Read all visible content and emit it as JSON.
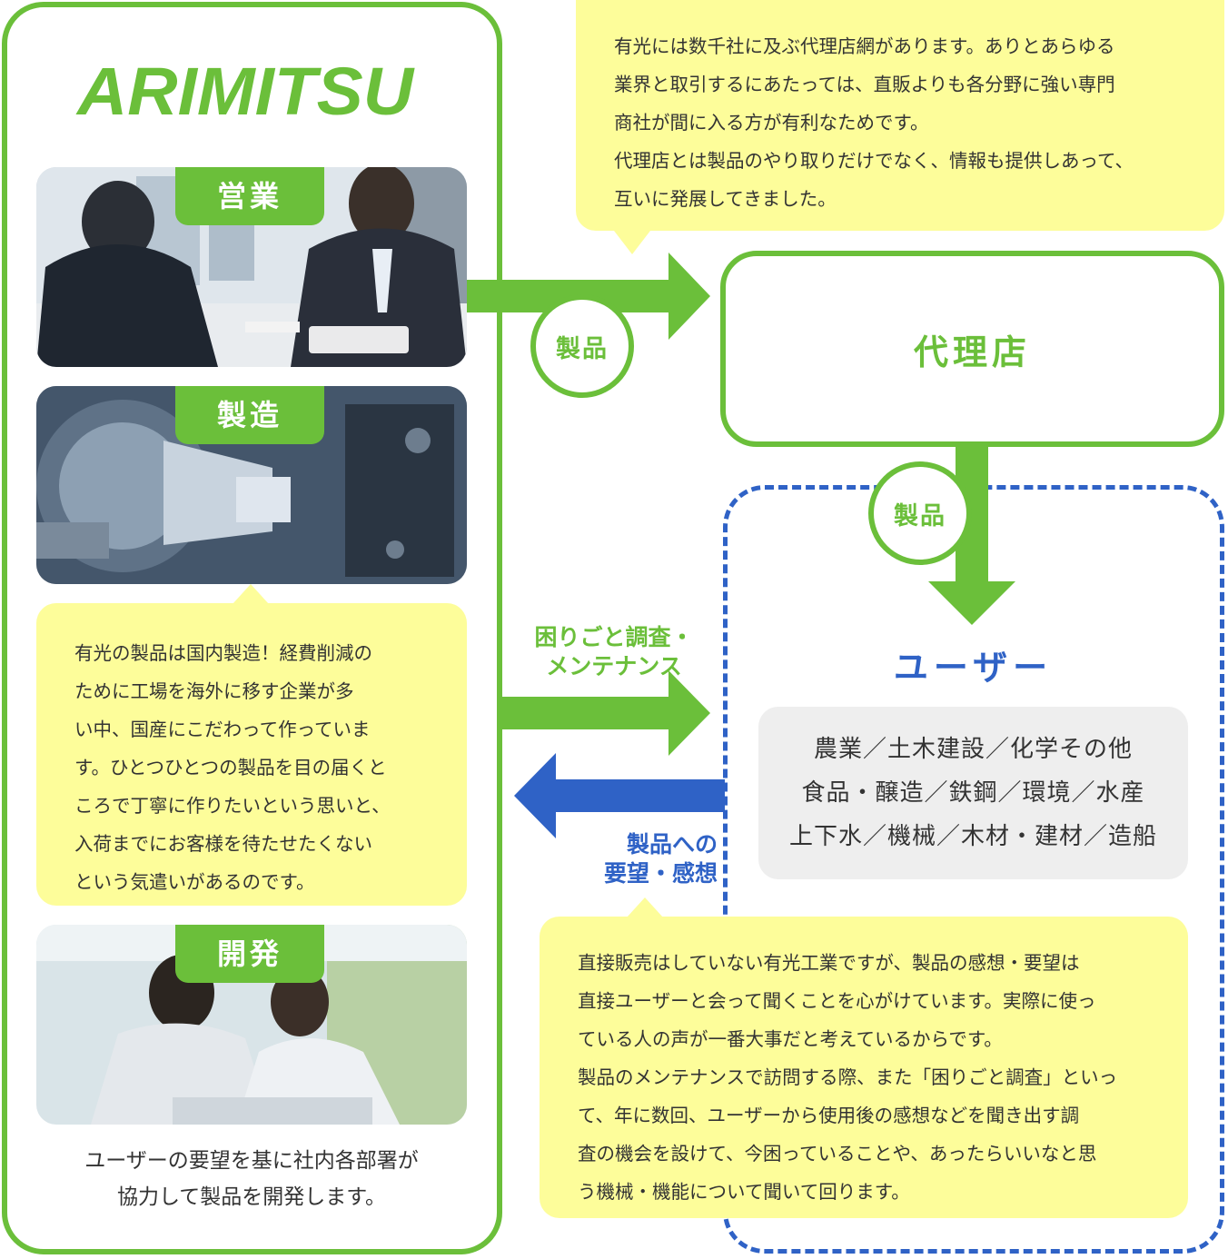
{
  "company": {
    "logo_text": "ARIMITSU",
    "sales_tag": "営業",
    "manufacturing_tag": "製造",
    "development_tag": "開発",
    "manufacturing_note": [
      "有光の製品は国内製造！経費削減の",
      "ために工場を海外に移す企業が多",
      "い中、国産にこだわって作っていま",
      "す。ひとつひとつの製品を目の届くと",
      "ころで丁寧に作りたいという思いと、",
      "入荷までにお客様を待たせたくない",
      "という気遣いがあるのです。"
    ],
    "development_note": [
      "ユーザーの要望を基に社内各部署が",
      "協力して製品を開発します。"
    ]
  },
  "dealer": {
    "label": "代理店",
    "note": [
      "有光には数千社に及ぶ代理店網があります。ありとあらゆる",
      "業界と取引するにあたっては、直販よりも各分野に強い専門",
      "商社が間に入る方が有利なためです。",
      "代理店とは製品のやり取りだけでなく、情報も提供しあって、",
      "互いに発展してきました。"
    ]
  },
  "flows": {
    "product_to_dealer": "製品",
    "product_to_user": "製品",
    "service": [
      "困りごと調査・",
      "メンテナンス"
    ],
    "feedback": [
      "製品への",
      "要望・感想"
    ]
  },
  "user": {
    "title": "ユーザー",
    "industries": [
      "農業／土木建設／化学その他",
      "食品・醸造／鉄鋼／環境／水産",
      "上下水／機械／木材・建材／造船"
    ],
    "note": [
      "直接販売はしていない有光工業ですが、製品の感想・要望は",
      "直接ユーザーと会って聞くことを心がけています。実際に使っ",
      "ている人の声が一番大事だと考えているからです。",
      "製品のメンテナンスで訪問する際、また「困りごと調査」といっ",
      "て、年に数回、ユーザーから使用後の感想などを聞き出す調",
      "査の機会を設けて、今困っていることや、あったらいいなと思",
      "う機械・機能について聞いて回ります。"
    ]
  },
  "colors": {
    "green": "#6bbf3a",
    "blue": "#2f62c6",
    "yellow": "#fdfd9a",
    "gray": "#eeeeee"
  }
}
